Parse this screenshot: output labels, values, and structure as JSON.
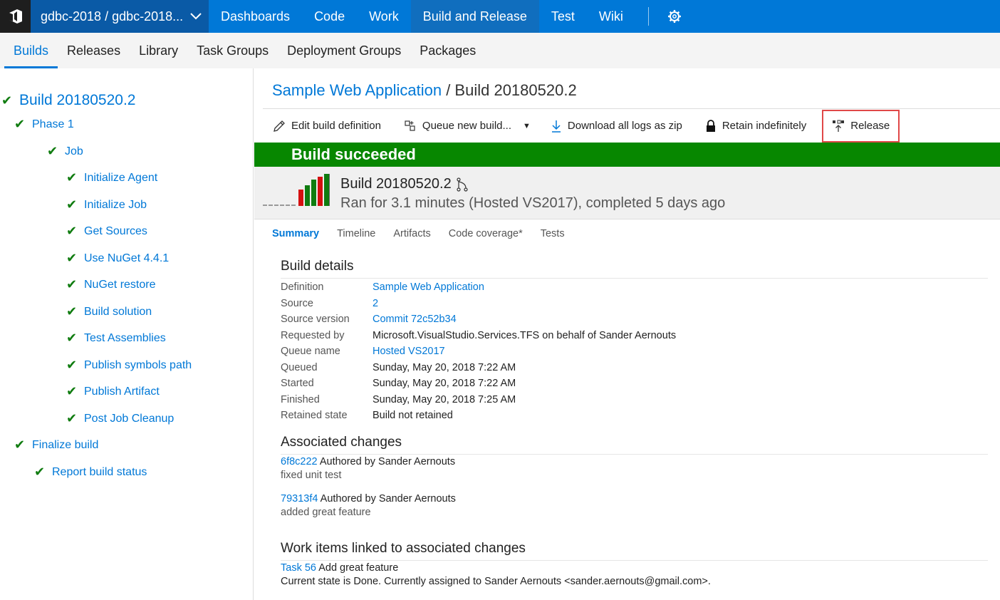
{
  "topbar": {
    "project": "gdbc-2018 / gdbc-2018...",
    "nav": [
      "Dashboards",
      "Code",
      "Work",
      "Build and Release",
      "Test",
      "Wiki"
    ],
    "active_nav": "Build and Release",
    "accent": "#0078d7"
  },
  "subnav": [
    "Builds",
    "Releases",
    "Library",
    "Task Groups",
    "Deployment Groups",
    "Packages"
  ],
  "tree": [
    {
      "label": "Build 20180520.2",
      "level": 0
    },
    {
      "label": "Phase 1",
      "level": 1
    },
    {
      "label": "Job",
      "level": 2
    },
    {
      "label": "Initialize Agent",
      "level": 3
    },
    {
      "label": "Initialize Job",
      "level": 3
    },
    {
      "label": "Get Sources",
      "level": 3
    },
    {
      "label": "Use NuGet 4.4.1",
      "level": 3
    },
    {
      "label": "NuGet restore",
      "level": 3
    },
    {
      "label": "Build solution",
      "level": 3
    },
    {
      "label": "Test Assemblies",
      "level": 3
    },
    {
      "label": "Publish symbols path",
      "level": 3
    },
    {
      "label": "Publish Artifact",
      "level": 3
    },
    {
      "label": "Post Job Cleanup",
      "level": 3
    },
    {
      "label": "Finalize build",
      "level": 1
    },
    {
      "label": "Report build status",
      "level": 2
    }
  ],
  "breadcrumb": {
    "link": "Sample Web Application",
    "sep": " / ",
    "current": "Build 20180520.2"
  },
  "toolbar": {
    "edit": "Edit build definition",
    "queue": "Queue new build...",
    "download": "Download all logs as zip",
    "retain": "Retain indefinitely",
    "release": "Release"
  },
  "banner": {
    "text": "Build succeeded",
    "color": "#078700"
  },
  "build": {
    "title": "Build 20180520.2",
    "subtitle": "Ran for 3.1 minutes (Hosted VS2017), completed 5 days ago"
  },
  "tabs": [
    "Summary",
    "Timeline",
    "Artifacts",
    "Code coverage*",
    "Tests"
  ],
  "details": {
    "title": "Build details",
    "rows": [
      {
        "key": "Definition",
        "value": "Sample Web Application",
        "link": true
      },
      {
        "key": "Source",
        "value": "2",
        "link": true
      },
      {
        "key": "Source version",
        "value": "Commit 72c52b34",
        "link": true
      },
      {
        "key": "Requested by",
        "value": "Microsoft.VisualStudio.Services.TFS on behalf of Sander Aernouts",
        "link": false
      },
      {
        "key": "Queue name",
        "value": "Hosted VS2017",
        "link": true
      },
      {
        "key": "Queued",
        "value": "Sunday, May 20, 2018 7:22 AM",
        "link": false
      },
      {
        "key": "Started",
        "value": "Sunday, May 20, 2018 7:22 AM",
        "link": false
      },
      {
        "key": "Finished",
        "value": "Sunday, May 20, 2018 7:25 AM",
        "link": false
      },
      {
        "key": "Retained state",
        "value": "Build not retained",
        "link": false
      }
    ]
  },
  "changes": {
    "title": "Associated changes",
    "items": [
      {
        "id": "6f8c222",
        "author": " Authored by Sander Aernouts",
        "message": "fixed unit test"
      },
      {
        "id": "79313f4",
        "author": " Authored by Sander Aernouts",
        "message": "added great feature"
      }
    ]
  },
  "workitems": {
    "title": "Work items linked to associated changes",
    "items": [
      {
        "id": "Task 56",
        "title": " Add great feature",
        "state": "Current state is Done. Currently assigned to Sander Aernouts <sander.aernouts@gmail.com>."
      }
    ]
  }
}
